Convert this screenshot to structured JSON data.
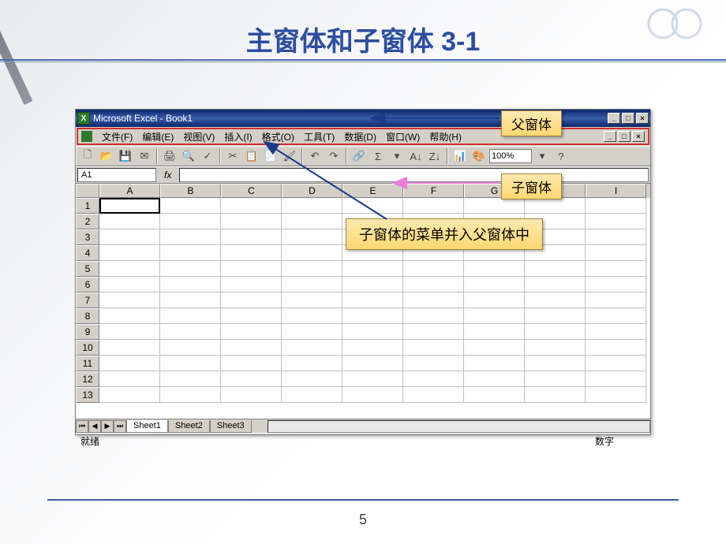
{
  "slide": {
    "title": "主窗体和子窗体 3-1",
    "page_number": "5"
  },
  "callouts": {
    "parent": "父窗体",
    "child": "子窗体",
    "merge_note": "子窗体的菜单并入父窗体中"
  },
  "excel": {
    "title": "Microsoft Excel - Book1",
    "menu": [
      "文件(F)",
      "编辑(E)",
      "视图(V)",
      "插入(I)",
      "格式(O)",
      "工具(T)",
      "数据(D)",
      "窗口(W)",
      "帮助(H)"
    ],
    "zoom": "100%",
    "name_box": "A1",
    "fx": "fx",
    "columns": [
      "A",
      "B",
      "C",
      "D",
      "E",
      "F",
      "G",
      "H",
      "I"
    ],
    "rows": [
      "1",
      "2",
      "3",
      "4",
      "5",
      "6",
      "7",
      "8",
      "9",
      "10",
      "11",
      "12",
      "13"
    ],
    "sheet_tabs": [
      "Sheet1",
      "Sheet2",
      "Sheet3"
    ],
    "status_ready": "就绪",
    "status_num": "数字"
  }
}
